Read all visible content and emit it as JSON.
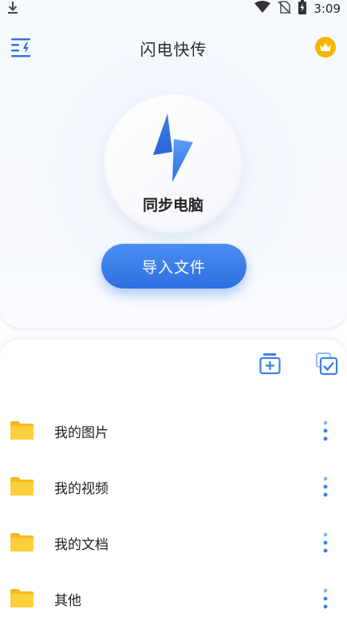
{
  "status_bar": {
    "time": "3:09",
    "icons": [
      "download-icon",
      "wifi-icon",
      "no-sim-icon",
      "battery-charging-icon"
    ]
  },
  "header": {
    "title": "闪电快传",
    "left_icon": "menu-lightning-icon",
    "right_icon": "crown-icon"
  },
  "sync": {
    "label": "同步电脑",
    "icon": "lightning-bolt-icon"
  },
  "import_button": {
    "label": "导入文件"
  },
  "toolbar": {
    "icons": [
      "new-folder-icon",
      "multi-select-icon"
    ]
  },
  "folders": [
    {
      "label": "我的图片"
    },
    {
      "label": "我的视频"
    },
    {
      "label": "我的文档"
    },
    {
      "label": "其他"
    }
  ],
  "colors": {
    "accent": "#3a7fea",
    "folder": "#f9c42c",
    "crown": "#f7b500"
  }
}
